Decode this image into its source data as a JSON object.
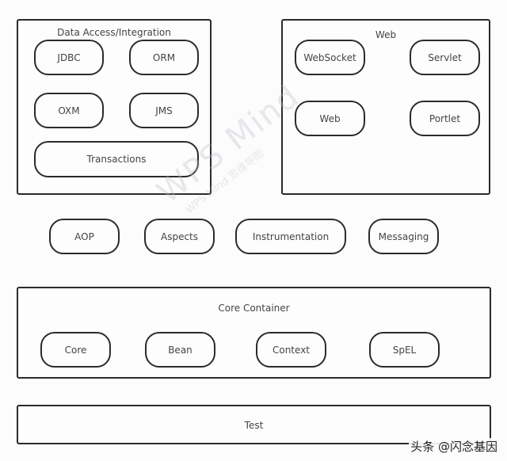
{
  "diagram": {
    "data_access": {
      "title": "Data Access/Integration",
      "modules": [
        "JDBC",
        "ORM",
        "OXM",
        "JMS",
        "Transactions"
      ]
    },
    "web": {
      "title": "Web",
      "modules": [
        "WebSocket",
        "Servlet",
        "Web",
        "Portlet"
      ]
    },
    "middle": {
      "modules": [
        "AOP",
        "Aspects",
        "Instrumentation",
        "Messaging"
      ]
    },
    "core_container": {
      "title": "Core Container",
      "modules": [
        "Core",
        "Bean",
        "Context",
        "SpEL"
      ]
    },
    "test": {
      "title": "Test"
    }
  },
  "watermark": {
    "main": "WPS Mind",
    "sub": "WPS Mind 思维导图"
  },
  "credit": "头条 @闪念基因"
}
